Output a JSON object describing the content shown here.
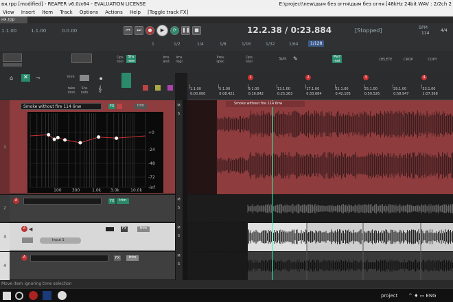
{
  "window": {
    "title": "вя.rpp [modified] - REAPER v6.0/x64 - EVALUATION LICENSE",
    "path": "E:\\project\\new\\дым без огня\\дым без огня [48kHz 24bit WAV : 2/2ch 2"
  },
  "menu": [
    "View",
    "Insert",
    "Item",
    "Track",
    "Options",
    "Actions",
    "Help",
    "[Toggle track FX]"
  ],
  "tab": {
    "label": "ня.rpp"
  },
  "transport": {
    "readouts": [
      "1.1.00",
      "1.1.00",
      "0.0.00"
    ],
    "position": "12.2.38 / 0:23.884",
    "state": "[Stopped]",
    "bpm_label": "BPM",
    "bpm": "114",
    "sig": "4/4",
    "grid": [
      "1",
      "1/2",
      "1/4",
      "1/8",
      "1/16",
      "1/32",
      "1/64",
      "1/128"
    ]
  },
  "toolbar": {
    "buttons": [
      "Ops\ntool",
      "Shs\nnew",
      "Ims\nand",
      "Ims\nregi",
      "Prev\nspec",
      "Ops\ntool",
      "Split",
      "Perf\nmet",
      "DELETE",
      "CROP",
      "COPY"
    ]
  },
  "tcp_tools": [
    "reve",
    "take\nmon",
    "Shs\nnots"
  ],
  "ruler": {
    "markers": [
      "1",
      "2",
      "3",
      "4"
    ],
    "bars": [
      {
        "bar": "1.1.00",
        "time": "0:00.000"
      },
      {
        "bar": "5.1.00",
        "time": "0:08.421"
      },
      {
        "bar": "9.1.00",
        "time": "0:16.842"
      },
      {
        "bar": "13.1.00",
        "time": "0:25.263"
      },
      {
        "bar": "17.1.00",
        "time": "0:33.684"
      },
      {
        "bar": "21.1.00",
        "time": "0:42.105"
      },
      {
        "bar": "25.1.00",
        "time": "0:50.526"
      },
      {
        "bar": "29.1.00",
        "time": "0:58.947"
      },
      {
        "bar": "33.1.00",
        "time": "1:07.368"
      }
    ]
  },
  "tracks": [
    {
      "num": "1",
      "name": "Smoke without fire 114 6nw",
      "item": "Smoke without fire 114 6nw"
    },
    {
      "num": "2",
      "name": "",
      "item": ""
    },
    {
      "num": "3",
      "name": "",
      "input": "Input 1",
      "item": ""
    },
    {
      "num": "4",
      "name": "",
      "item": ""
    }
  ],
  "eq": {
    "db_labels": [
      "+0",
      "-24",
      "-48",
      "-72",
      "-inf"
    ],
    "db_values": [
      "+6",
      "-24",
      "-48",
      "-72",
      "-90"
    ],
    "freq_labels": [
      "100",
      "300",
      "1.0k",
      "3.0k",
      "10.0k"
    ],
    "points": [
      {
        "f": "60",
        "g": "2"
      },
      {
        "f": "85",
        "g": "-6"
      },
      {
        "f": "105",
        "g": "-3"
      },
      {
        "f": "160",
        "g": "-7"
      },
      {
        "f": "400",
        "g": "-12"
      },
      {
        "f": "1200",
        "g": "-2"
      },
      {
        "f": "3500",
        "g": "-4"
      }
    ]
  },
  "status": "Move item ignoring time selection",
  "taskbar": {
    "project_label": "project",
    "clock_lang": "^ ♦ ▭ ENG"
  },
  "colors": {
    "accent": "#2a8a6a",
    "track1": "#8e3c3e",
    "record": "#b33333",
    "selected_item": "#e0e0e0"
  }
}
